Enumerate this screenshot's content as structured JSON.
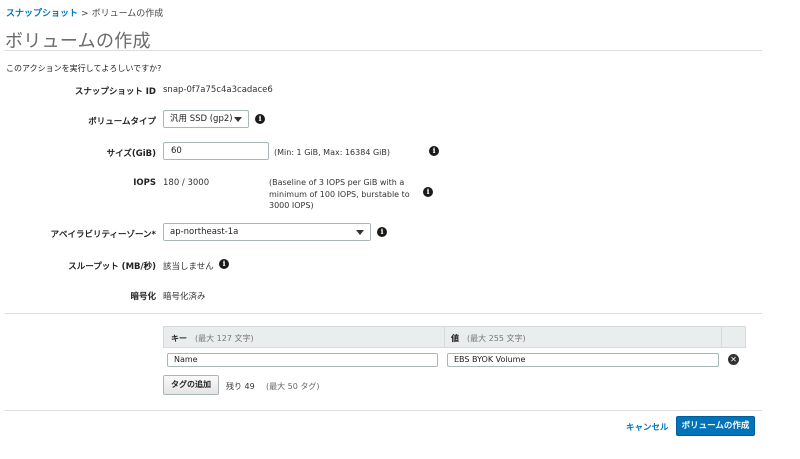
{
  "breadcrumb": {
    "parent": "スナップショット",
    "separator": ">",
    "current": "ボリュームの作成"
  },
  "page_title": "ボリュームの作成",
  "confirm_text": "このアクションを実行してよろしいですか?",
  "fields": {
    "snapshot_id": {
      "label": "スナップショット ID",
      "value": "snap-0f7a75c4a3cadace6"
    },
    "volume_type": {
      "label": "ボリュームタイプ",
      "value": "汎用 SSD (gp2)"
    },
    "size": {
      "label": "サイズ(GiB)",
      "value": "60",
      "hint": "(Min: 1 GiB, Max: 16384 GiB)"
    },
    "iops": {
      "label": "IOPS",
      "value": "180 / 3000",
      "hint_lines": [
        "(Baseline of 3 IOPS per GiB with a",
        "minimum of 100 IOPS, burstable to",
        "3000 IOPS)"
      ]
    },
    "az": {
      "label": "アベイラビリティーゾーン*",
      "value": "ap-northeast-1a"
    },
    "throughput": {
      "label": "スループット (MB/秒)",
      "value": "該当しません"
    },
    "encryption": {
      "label": "暗号化",
      "value": "暗号化済み"
    }
  },
  "tags": {
    "key_header": "キー",
    "key_limit": "(最大 127 文字)",
    "value_header": "値",
    "value_limit": "(最大 255 文字)",
    "rows": [
      {
        "key": "Name",
        "value": "EBS BYOK Volume"
      }
    ],
    "add_button": "タグの追加",
    "remaining": "残り 49",
    "remaining_max": "(最大 50 タグ)"
  },
  "footer": {
    "cancel": "キャンセル",
    "create": "ボリュームの作成"
  },
  "colors": {
    "accent": "#0073bb",
    "title_gray": "#6b6b6b"
  }
}
